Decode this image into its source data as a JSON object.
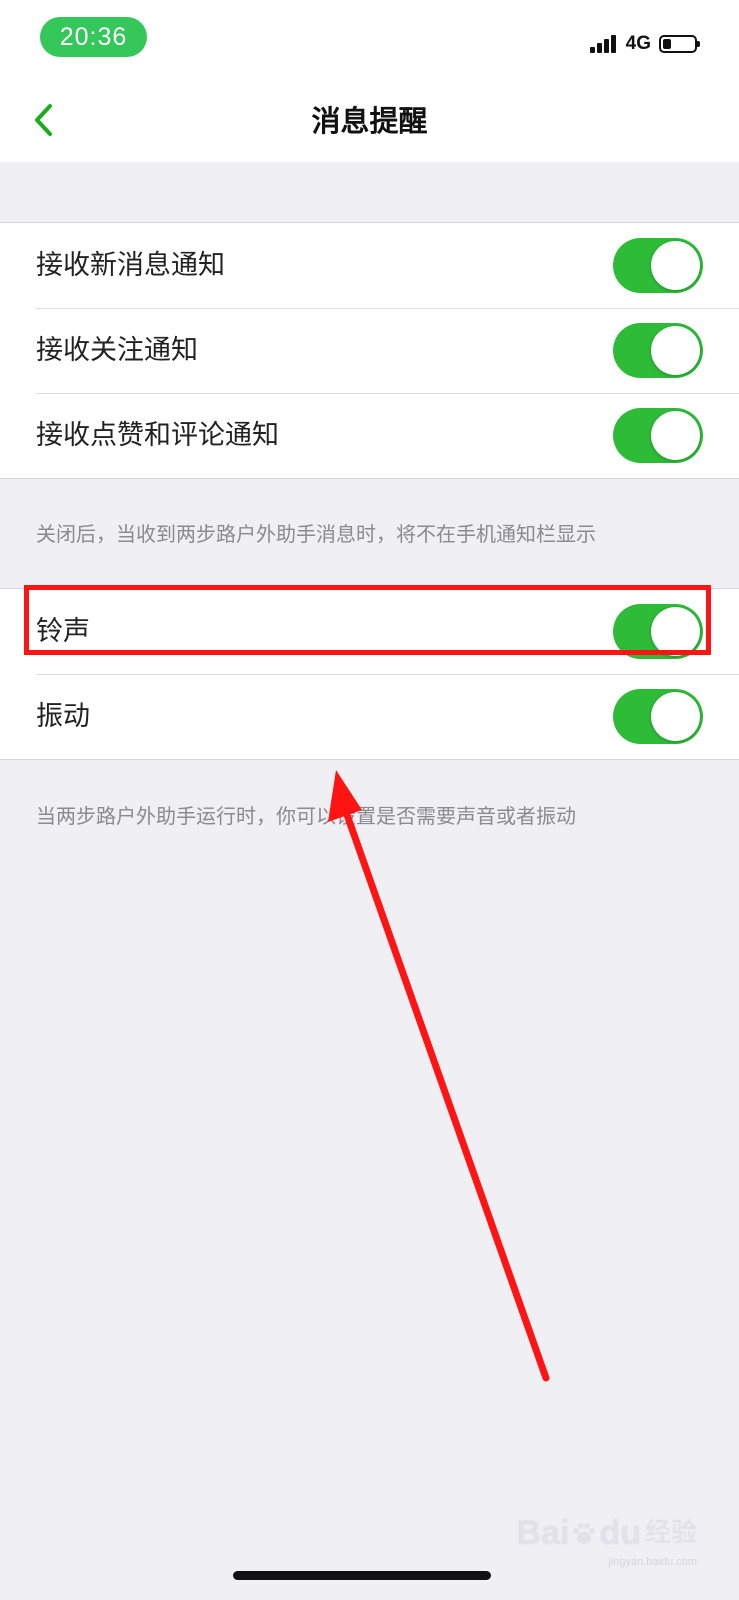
{
  "status_bar": {
    "time": "20:36",
    "network": "4G",
    "battery_level_fraction": 0.25
  },
  "nav": {
    "back_icon": "chevron-left-icon",
    "title": "消息提醒",
    "accent_color": "#1aad19"
  },
  "notification_group": {
    "items": [
      {
        "label": "接收新消息通知",
        "enabled": true
      },
      {
        "label": "接收关注通知",
        "enabled": true
      },
      {
        "label": "接收点赞和评论通知",
        "enabled": true
      }
    ],
    "footnote": "关闭后，当收到两步路户外助手消息时，将不在手机通知栏显示"
  },
  "sound_group": {
    "items": [
      {
        "label": "铃声",
        "enabled": true
      },
      {
        "label": "振动",
        "enabled": true
      }
    ],
    "footnote": "当两步路户外助手运行时，你可以设置是否需要声音或者振动"
  },
  "colors": {
    "switch_on": "#2dbb38",
    "annotation": "#ff1414",
    "background": "#efeff4"
  },
  "watermark": {
    "brand": "Bai",
    "brand_suffix": "du",
    "cn": "经验",
    "sub": "jingyan.baidu.com"
  }
}
